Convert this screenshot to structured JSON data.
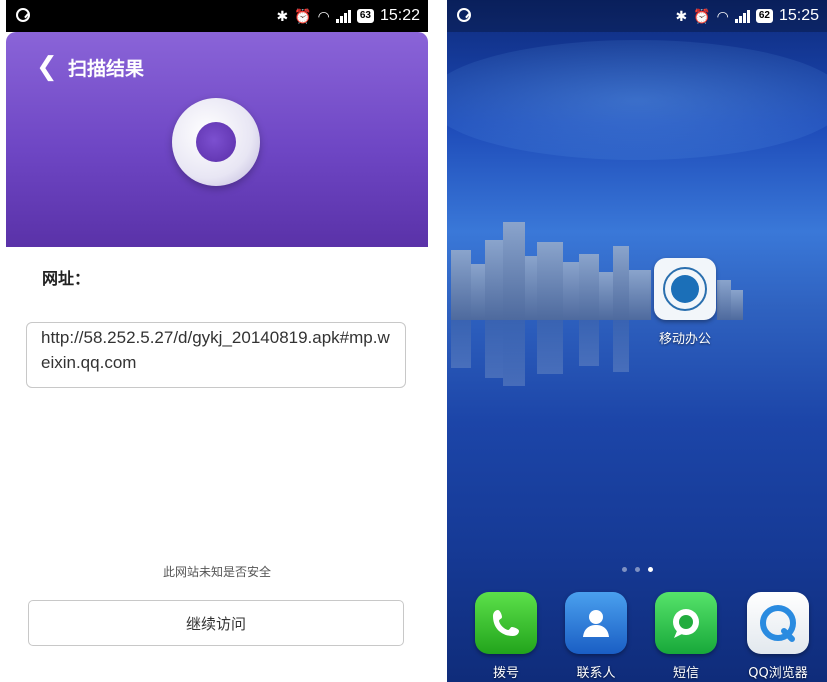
{
  "left_screen": {
    "status": {
      "time": "15:22",
      "battery": "63"
    },
    "header": {
      "back_label": "<",
      "title": "扫描结果"
    },
    "url_label": "网址：",
    "url_value": "http://58.252.5.27/d/gykj_20140819.apk#mp.weixin.qq.com",
    "warning": "此网站未知是否安全",
    "continue_label": "继续访问"
  },
  "right_screen": {
    "status": {
      "time": "15:25",
      "battery": "62"
    },
    "app": {
      "label": "移动办公"
    },
    "page_indicator": {
      "count": 3,
      "active": 3
    },
    "dock": [
      {
        "label": "拨号",
        "icon": "phone-icon"
      },
      {
        "label": "联系人",
        "icon": "contacts-icon"
      },
      {
        "label": "短信",
        "icon": "sms-icon"
      },
      {
        "label": "QQ浏览器",
        "icon": "qq-browser-icon"
      }
    ]
  },
  "colors": {
    "header_purple": "#7a52cc",
    "wallpaper_blue": "#1d4ab8"
  }
}
